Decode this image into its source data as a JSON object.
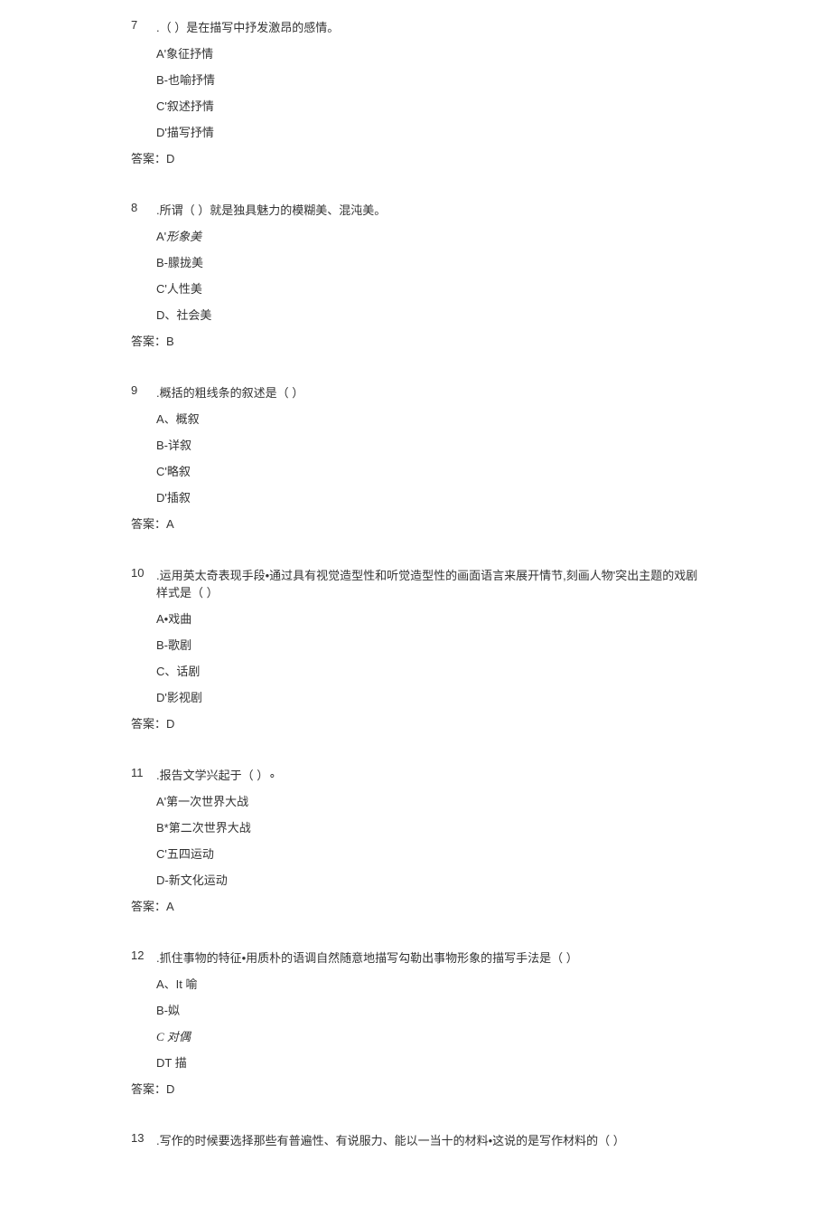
{
  "questions": [
    {
      "num": "7",
      "stem": ".（  ）是在描写中抒发激昂的感情。",
      "options": [
        "A'象征抒情",
        "B-也喻抒情",
        "C'叙述抒情",
        "D'描写抒情"
      ],
      "answer": "答案：D"
    },
    {
      "num": "8",
      "stem": ".所谓（  ）就是独具魅力的模糊美、混沌美。",
      "options": [
        "A'形象美",
        "B-朦拢美",
        "C'人性美",
        "D、社会美"
      ],
      "answer": "答案：B"
    },
    {
      "num": "9",
      "stem": ".概括的粗线条的叙述是（  ）",
      "options": [
        "A、概叙",
        "B-详叙",
        "C'略叙",
        "D'插叙"
      ],
      "answer": "答案：A"
    },
    {
      "num": "10",
      "stem": ".运用英太奇表现手段•通过具有视觉造型性和听觉造型性的画面语言来展开情节,刻画人物'突出主题的戏剧样式是（  ）",
      "options": [
        "A•戏曲",
        "B-歌剧",
        "C、话剧",
        "D'影视剧"
      ],
      "answer": "答案：D"
    },
    {
      "num": "11",
      "stem": ".报告文学兴起于（  ）∘",
      "options": [
        "A'第一次世界大战",
        "B*第二次世界大战",
        "C'五四运动",
        "D-新文化运动"
      ],
      "answer": "答案：A"
    },
    {
      "num": "12",
      "stem": ".抓住事物的特征•用质朴的语调自然随意地描写勾勒出事物形象的描写手法是（  ）",
      "options": [
        "A、It 喻",
        "B-姒",
        "C 对偶",
        "DT 描"
      ],
      "answer": "答案：D"
    },
    {
      "num": "13",
      "stem": ".写作的时候要选择那些有普遍性、有说服力、能以一当十的材料•这说的是写作材料的（  ）",
      "options": [],
      "answer": ""
    }
  ]
}
